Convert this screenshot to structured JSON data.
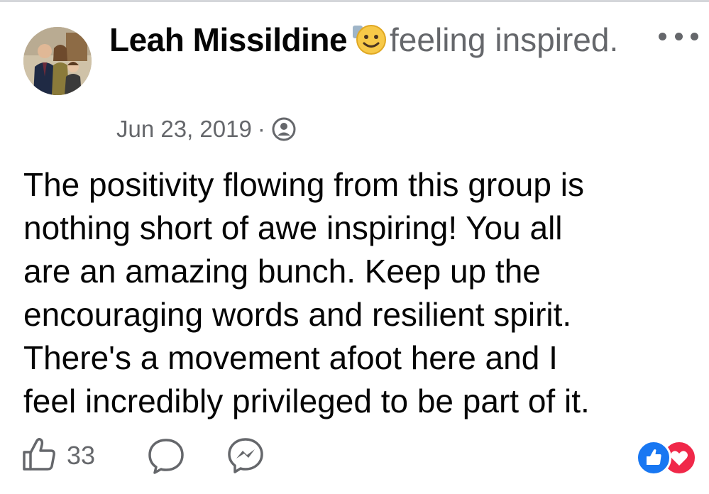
{
  "post": {
    "author": "Leah Missildine",
    "feeling_emoji": "smiling-face-emoji",
    "feeling": "feeling inspired.",
    "date": "Jun 23, 2019",
    "separator": "·",
    "privacy_icon": "friends-group-icon",
    "body": "The positivity flowing from this group is\nnothing short of awe inspiring!  You all\nare an amazing bunch.  Keep up the\nencouraging words and resilient spirit.\nThere's a movement afoot here and I\nfeel incredibly privileged to be part of it.",
    "more_menu_icon": "more-options-icon"
  },
  "actions": {
    "like_icon": "thumbs-up-icon",
    "like_count": "33",
    "comment_icon": "comment-icon",
    "share_icon": "messenger-icon"
  },
  "reactions": [
    {
      "type": "like",
      "icon": "like-reaction-icon",
      "color": "#1877f2"
    },
    {
      "type": "love",
      "icon": "love-reaction-icon",
      "color": "#f02849"
    }
  ],
  "colors": {
    "primary_text": "#050505",
    "secondary_text": "#65676b",
    "accent": "#1877f2",
    "love": "#f02849"
  }
}
